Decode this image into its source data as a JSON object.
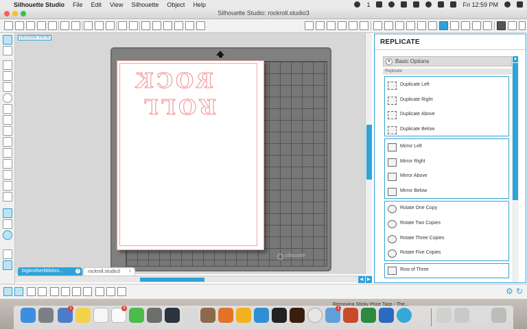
{
  "menubar": {
    "apple_glyph": "",
    "app_name": "Silhouette Studio",
    "items": [
      "File",
      "Edit",
      "View",
      "Silhouette",
      "Object",
      "Help"
    ],
    "status": {
      "badge_count": "1",
      "clock": "Fri 12:59 PM"
    }
  },
  "window": {
    "title": "Silhouette Studio: rockroll.studio3"
  },
  "canvas": {
    "view_label": "DESIGN VIEW",
    "mat_brand": "silhouette",
    "design_text": {
      "line1": "ROCK",
      "line2": "ROLL"
    }
  },
  "tabs": [
    {
      "label": "bigbrotherlittlebro...",
      "close": "x"
    },
    {
      "label": "rockroll.studio3",
      "close": "x"
    }
  ],
  "panel": {
    "title": "REPLICATE",
    "collapse_glyph": "▼",
    "basic_options": "Basic Options",
    "section_label": "Replicate",
    "duplicate_group": [
      {
        "label": "Duplicate Left",
        "icon": "duplicate-left-icon"
      },
      {
        "label": "Duplicate Right",
        "icon": "duplicate-right-icon"
      },
      {
        "label": "Duplicate Above",
        "icon": "duplicate-above-icon"
      },
      {
        "label": "Duplicate Below",
        "icon": "duplicate-below-icon"
      }
    ],
    "mirror_group": [
      {
        "label": "Mirror Left",
        "icon": "mirror-left-icon"
      },
      {
        "label": "Mirror Right",
        "icon": "mirror-right-icon"
      },
      {
        "label": "Mirror Above",
        "icon": "mirror-above-icon"
      },
      {
        "label": "Mirror Below",
        "icon": "mirror-below-icon"
      }
    ],
    "rotate_group": [
      {
        "label": "Rotate One Copy",
        "icon": "rotate-one-copy-icon"
      },
      {
        "label": "Rotate Two Copies",
        "icon": "rotate-two-copies-icon"
      },
      {
        "label": "Rotate Three Copies",
        "icon": "rotate-three-copies-icon"
      },
      {
        "label": "Rotate Five Copies",
        "icon": "rotate-five-copies-icon"
      }
    ],
    "row_group": [
      {
        "label": "Row of Three",
        "icon": "row-of-three-icon"
      }
    ]
  },
  "dock": {
    "badges": [
      "1",
      "8",
      "1"
    ],
    "background_note": "Removing Sticky Price Tags - The..."
  },
  "colors": {
    "accent": "#2fa3d8",
    "cut_line": "#f08a8a",
    "mat": "#808080"
  }
}
